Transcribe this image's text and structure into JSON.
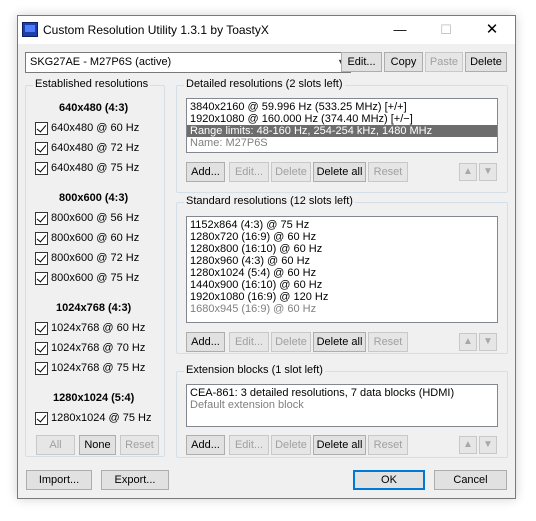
{
  "window": {
    "title": "Custom Resolution Utility 1.3.1 by ToastyX",
    "min_glyph": "—",
    "max_glyph": "☐",
    "close_glyph": "✕"
  },
  "monitor": {
    "selected": "SKG27AE - M27P6S (active)",
    "buttons": {
      "edit": "Edit...",
      "copy": "Copy",
      "paste": "Paste",
      "delete": "Delete"
    }
  },
  "established": {
    "title": "Established resolutions",
    "groups": [
      {
        "heading": "640x480 (4:3)",
        "items": [
          "640x480 @ 60 Hz",
          "640x480 @ 72 Hz",
          "640x480 @ 75 Hz"
        ]
      },
      {
        "heading": "800x600 (4:3)",
        "items": [
          "800x600 @ 56 Hz",
          "800x600 @ 60 Hz",
          "800x600 @ 72 Hz",
          "800x600 @ 75 Hz"
        ]
      },
      {
        "heading": "1024x768 (4:3)",
        "items": [
          "1024x768 @ 60 Hz",
          "1024x768 @ 70 Hz",
          "1024x768 @ 75 Hz"
        ]
      },
      {
        "heading": "1280x1024 (5:4)",
        "items": [
          "1280x1024 @ 75 Hz"
        ]
      }
    ],
    "buttons": {
      "all": "All",
      "none": "None",
      "reset": "Reset"
    }
  },
  "detailed": {
    "title": "Detailed resolutions (2 slots left)",
    "rows": [
      "3840x2160 @ 59.996 Hz (533.25 MHz) [+/+]",
      "1920x1080 @ 160.000 Hz (374.40 MHz) [+/−]",
      "Range limits: 48-160 Hz, 254-254 kHz, 1480 MHz",
      "Name: M27P6S"
    ],
    "buttons": {
      "add": "Add...",
      "edit": "Edit...",
      "delete": "Delete",
      "delete_all": "Delete all",
      "reset": "Reset"
    }
  },
  "standard": {
    "title": "Standard resolutions (12 slots left)",
    "rows": [
      "1152x864 (4:3) @ 75 Hz",
      "1280x720 (16:9) @ 60 Hz",
      "1280x800 (16:10) @ 60 Hz",
      "1280x960 (4:3) @ 60 Hz",
      "1280x1024 (5:4) @ 60 Hz",
      "1440x900 (16:10) @ 60 Hz",
      "1920x1080 (16:9) @ 120 Hz",
      "1680x945 (16:9) @ 60 Hz"
    ],
    "buttons": {
      "add": "Add...",
      "edit": "Edit...",
      "delete": "Delete",
      "delete_all": "Delete all",
      "reset": "Reset"
    }
  },
  "extension": {
    "title": "Extension blocks (1 slot left)",
    "rows": [
      "CEA-861: 3 detailed resolutions, 7 data blocks (HDMI)",
      "Default extension block"
    ],
    "buttons": {
      "add": "Add...",
      "edit": "Edit...",
      "delete": "Delete",
      "delete_all": "Delete all",
      "reset": "Reset"
    }
  },
  "arrows": {
    "up": "▲",
    "down": "▼"
  },
  "footer": {
    "import": "Import...",
    "export": "Export...",
    "ok": "OK",
    "cancel": "Cancel"
  }
}
